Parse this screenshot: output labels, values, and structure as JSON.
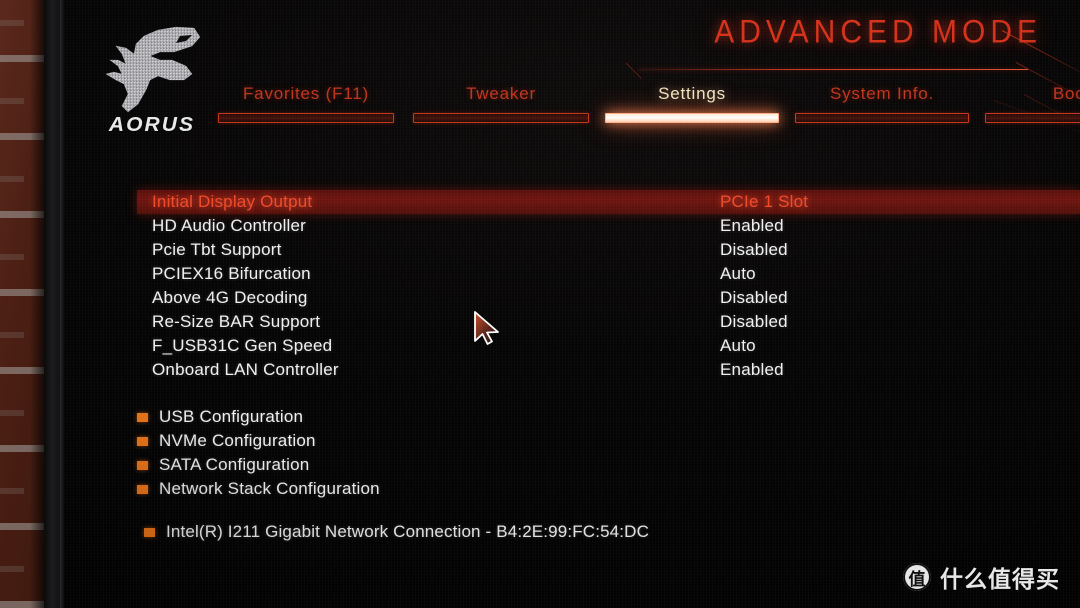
{
  "window": {
    "mode_title": "ADVANCED MODE",
    "brand": "AORUS",
    "brand_logo": "aorus-falcon-icon"
  },
  "colors": {
    "accent_red": "#d6311a",
    "selected_red": "#ef4a2a",
    "selected_row_bg": "#6e1510",
    "bullet_orange": "#ec7518",
    "text_white": "#f0f0f2",
    "active_tab_text": "#f2e2c0"
  },
  "tabs": [
    {
      "label": "Favorites (F11)",
      "active": false
    },
    {
      "label": "Tweaker",
      "active": false
    },
    {
      "label": "Settings",
      "active": true
    },
    {
      "label": "System Info.",
      "active": false
    },
    {
      "label": "Boot",
      "active": false
    }
  ],
  "settings": [
    {
      "name": "Initial Display Output",
      "value": "PCIe 1 Slot",
      "selected": true
    },
    {
      "name": "HD Audio Controller",
      "value": "Enabled",
      "selected": false
    },
    {
      "name": "Pcie Tbt Support",
      "value": "Disabled",
      "selected": false
    },
    {
      "name": "PCIEX16 Bifurcation",
      "value": "Auto",
      "selected": false
    },
    {
      "name": "Above 4G Decoding",
      "value": "Disabled",
      "selected": false
    },
    {
      "name": "Re-Size BAR Support",
      "value": "Disabled",
      "selected": false
    },
    {
      "name": "F_USB31C Gen Speed",
      "value": "Auto",
      "selected": false
    },
    {
      "name": "Onboard LAN Controller",
      "value": "Enabled",
      "selected": false
    }
  ],
  "submenus": [
    {
      "label": "USB Configuration"
    },
    {
      "label": "NVMe Configuration"
    },
    {
      "label": "SATA Configuration"
    },
    {
      "label": "Network Stack Configuration"
    }
  ],
  "nic": {
    "label": "Intel(R) I211 Gigabit  Network Connection - B4:2E:99:FC:54:DC"
  },
  "watermark": {
    "badge": "值",
    "text": "什么值得买"
  }
}
